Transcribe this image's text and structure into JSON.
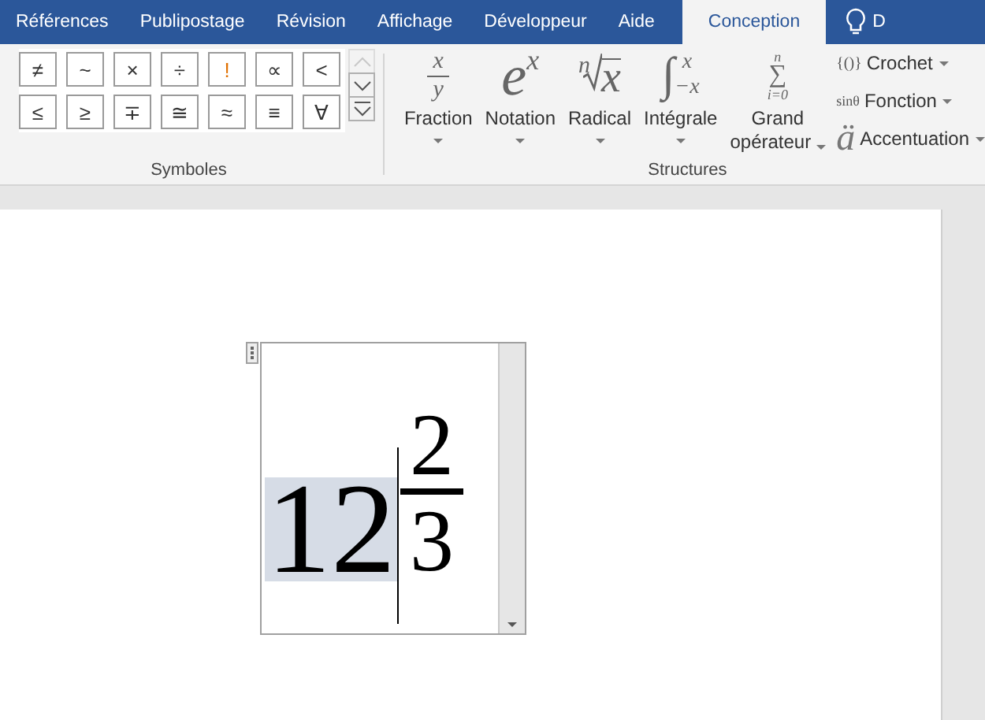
{
  "tabs": [
    {
      "label": "Références",
      "selected": false
    },
    {
      "label": "Publipostage",
      "selected": false
    },
    {
      "label": "Révision",
      "selected": false
    },
    {
      "label": "Affichage",
      "selected": false
    },
    {
      "label": "Développeur",
      "selected": false
    },
    {
      "label": "Aide",
      "selected": false
    },
    {
      "label": "Conception",
      "selected": true
    }
  ],
  "tell_me": {
    "text": "D"
  },
  "symbols": {
    "label": "Symboles",
    "rows": [
      [
        "≠",
        "~",
        "×",
        "÷",
        "!",
        "∝",
        "<"
      ],
      [
        "≤",
        "≥",
        "∓",
        "≅",
        "≈",
        "≡",
        "∀"
      ]
    ]
  },
  "structures": {
    "label": "Structures",
    "large": [
      {
        "kind": "fraction",
        "label": "Fraction",
        "a": "x",
        "b": "y"
      },
      {
        "kind": "script",
        "label": "Notation",
        "a": "e",
        "b": "x"
      },
      {
        "kind": "radical",
        "label": "Radical",
        "a": "n",
        "b": "x"
      },
      {
        "kind": "integral",
        "label": "Intégrale",
        "a": "∫",
        "b": "x",
        "c": "−x"
      },
      {
        "kind": "operator",
        "label": "Grand opérateur",
        "a": "∑",
        "b": "n",
        "c": "i=0"
      }
    ],
    "small": [
      {
        "icon": "{()}",
        "label": "Crochet"
      },
      {
        "icon": "sinθ",
        "label": "Fonction"
      },
      {
        "icon": "ä",
        "label": "Accentuation"
      }
    ]
  },
  "equation": {
    "whole": "12",
    "whole_selected": true,
    "numerator": "2",
    "denominator": "3"
  }
}
